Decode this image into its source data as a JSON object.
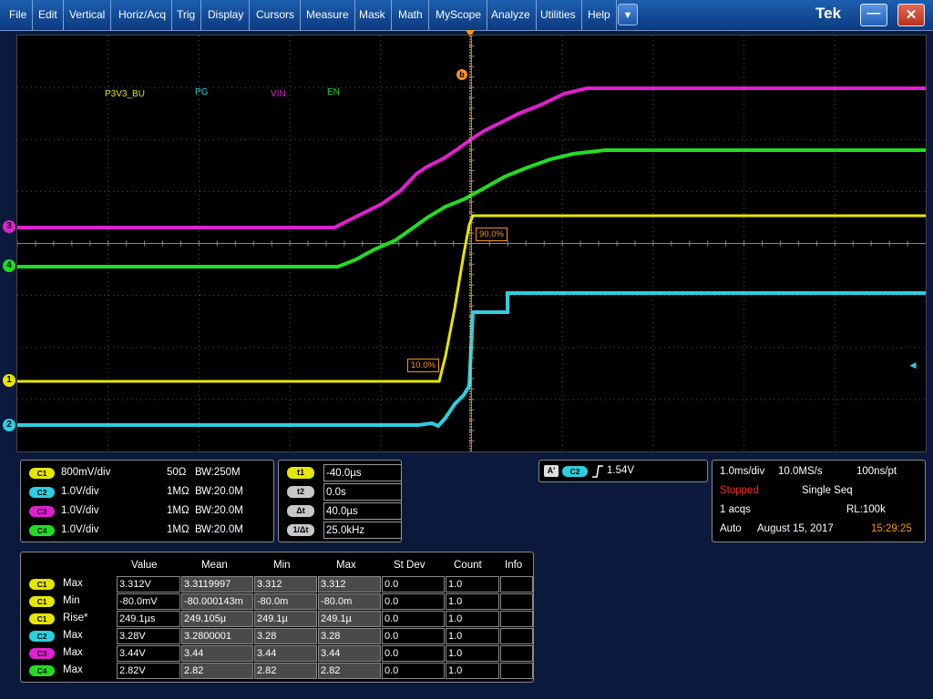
{
  "menu": {
    "items": [
      "File",
      "Edit",
      "Vertical",
      "Horiz/Acq",
      "Trig",
      "Display",
      "Cursors",
      "Measure",
      "Mask",
      "Math",
      "MyScope",
      "Analyze",
      "Utilities",
      "Help"
    ],
    "dropdown_glyph": "▼",
    "logo": "Tek",
    "minimize_glyph": "—",
    "close_glyph": "✕"
  },
  "waveform_labels": {
    "p3v3_bu": "P3V3_BU",
    "pg": "PG",
    "vin": "VIN",
    "en": "EN"
  },
  "channel_indicators": {
    "c3": "3",
    "c4": "4",
    "c1": "1",
    "c2": "2"
  },
  "cursor": {
    "marker_b": "b",
    "label_90": "90.0%",
    "label_10": "10.0%"
  },
  "channels": [
    {
      "chip": "C1",
      "scale": "800mV/div",
      "impedance": "50Ω",
      "bw": "W:250M"
    },
    {
      "chip": "C2",
      "scale": "1.0V/div",
      "impedance": "1MΩ",
      "bw": "W:20.0M"
    },
    {
      "chip": "C3",
      "scale": "1.0V/div",
      "impedance": "1MΩ",
      "bw": "W:20.0M"
    },
    {
      "chip": "C4",
      "scale": "1.0V/div",
      "impedance": "1MΩ",
      "bw": "W:20.0M"
    }
  ],
  "bw_prefix": "B",
  "cursor_readout": [
    {
      "label": "t1",
      "value": "-40.0µs"
    },
    {
      "label": "t2",
      "value": "0.0s"
    },
    {
      "label": "Δt",
      "value": "40.0µs"
    },
    {
      "label": "1/Δt",
      "value": "25.0kHz"
    }
  ],
  "trigger": {
    "mode": "A'",
    "source": "C2",
    "slope_icon": "rising-edge",
    "level": "1.54V"
  },
  "acquisition": {
    "time_div": "1.0ms/div",
    "sample_rate": "10.0MS/s",
    "resolution": "100ns/pt",
    "status": "Stopped",
    "seq": "Single Seq",
    "acqs": "1 acqs",
    "rl": "RL:100k",
    "trigger_mode": "Auto",
    "date": "August 15, 2017",
    "time": "15:29:25"
  },
  "measurements": {
    "headers": [
      "Value",
      "Mean",
      "Min",
      "Max",
      "St Dev",
      "Count",
      "Info"
    ],
    "rows": [
      {
        "chip": "C1",
        "type": "Max",
        "value": "3.312V",
        "mean": "3.3119997",
        "min": "3.312",
        "max": "3.312",
        "stdev": "0.0",
        "count": "1.0",
        "info": ""
      },
      {
        "chip": "C1",
        "type": "Min",
        "value": "-80.0mV",
        "mean": "-80.000143m",
        "min": "-80.0m",
        "max": "-80.0m",
        "stdev": "0.0",
        "count": "1.0",
        "info": ""
      },
      {
        "chip": "C1",
        "type": "Rise*",
        "value": "249.1µs",
        "mean": "249.105µ",
        "min": "249.1µ",
        "max": "249.1µ",
        "stdev": "0.0",
        "count": "1.0",
        "info": ""
      },
      {
        "chip": "C2",
        "type": "Max",
        "value": "3.28V",
        "mean": "3.2800001",
        "min": "3.28",
        "max": "3.28",
        "stdev": "0.0",
        "count": "1.0",
        "info": ""
      },
      {
        "chip": "C3",
        "type": "Max",
        "value": "3.44V",
        "mean": "3.44",
        "min": "3.44",
        "max": "3.44",
        "stdev": "0.0",
        "count": "1.0",
        "info": ""
      },
      {
        "chip": "C4",
        "type": "Max",
        "value": "2.82V",
        "mean": "2.82",
        "min": "2.82",
        "max": "2.82",
        "stdev": "0.0",
        "count": "1.0",
        "info": ""
      }
    ]
  },
  "colors": {
    "c1": "#e6e600",
    "c2": "#2bd0e0",
    "c3": "#e020d0",
    "c4": "#22dd22",
    "cursor": "#f7941d",
    "stopped": "#ff2a2a",
    "time": "#f7941d"
  }
}
